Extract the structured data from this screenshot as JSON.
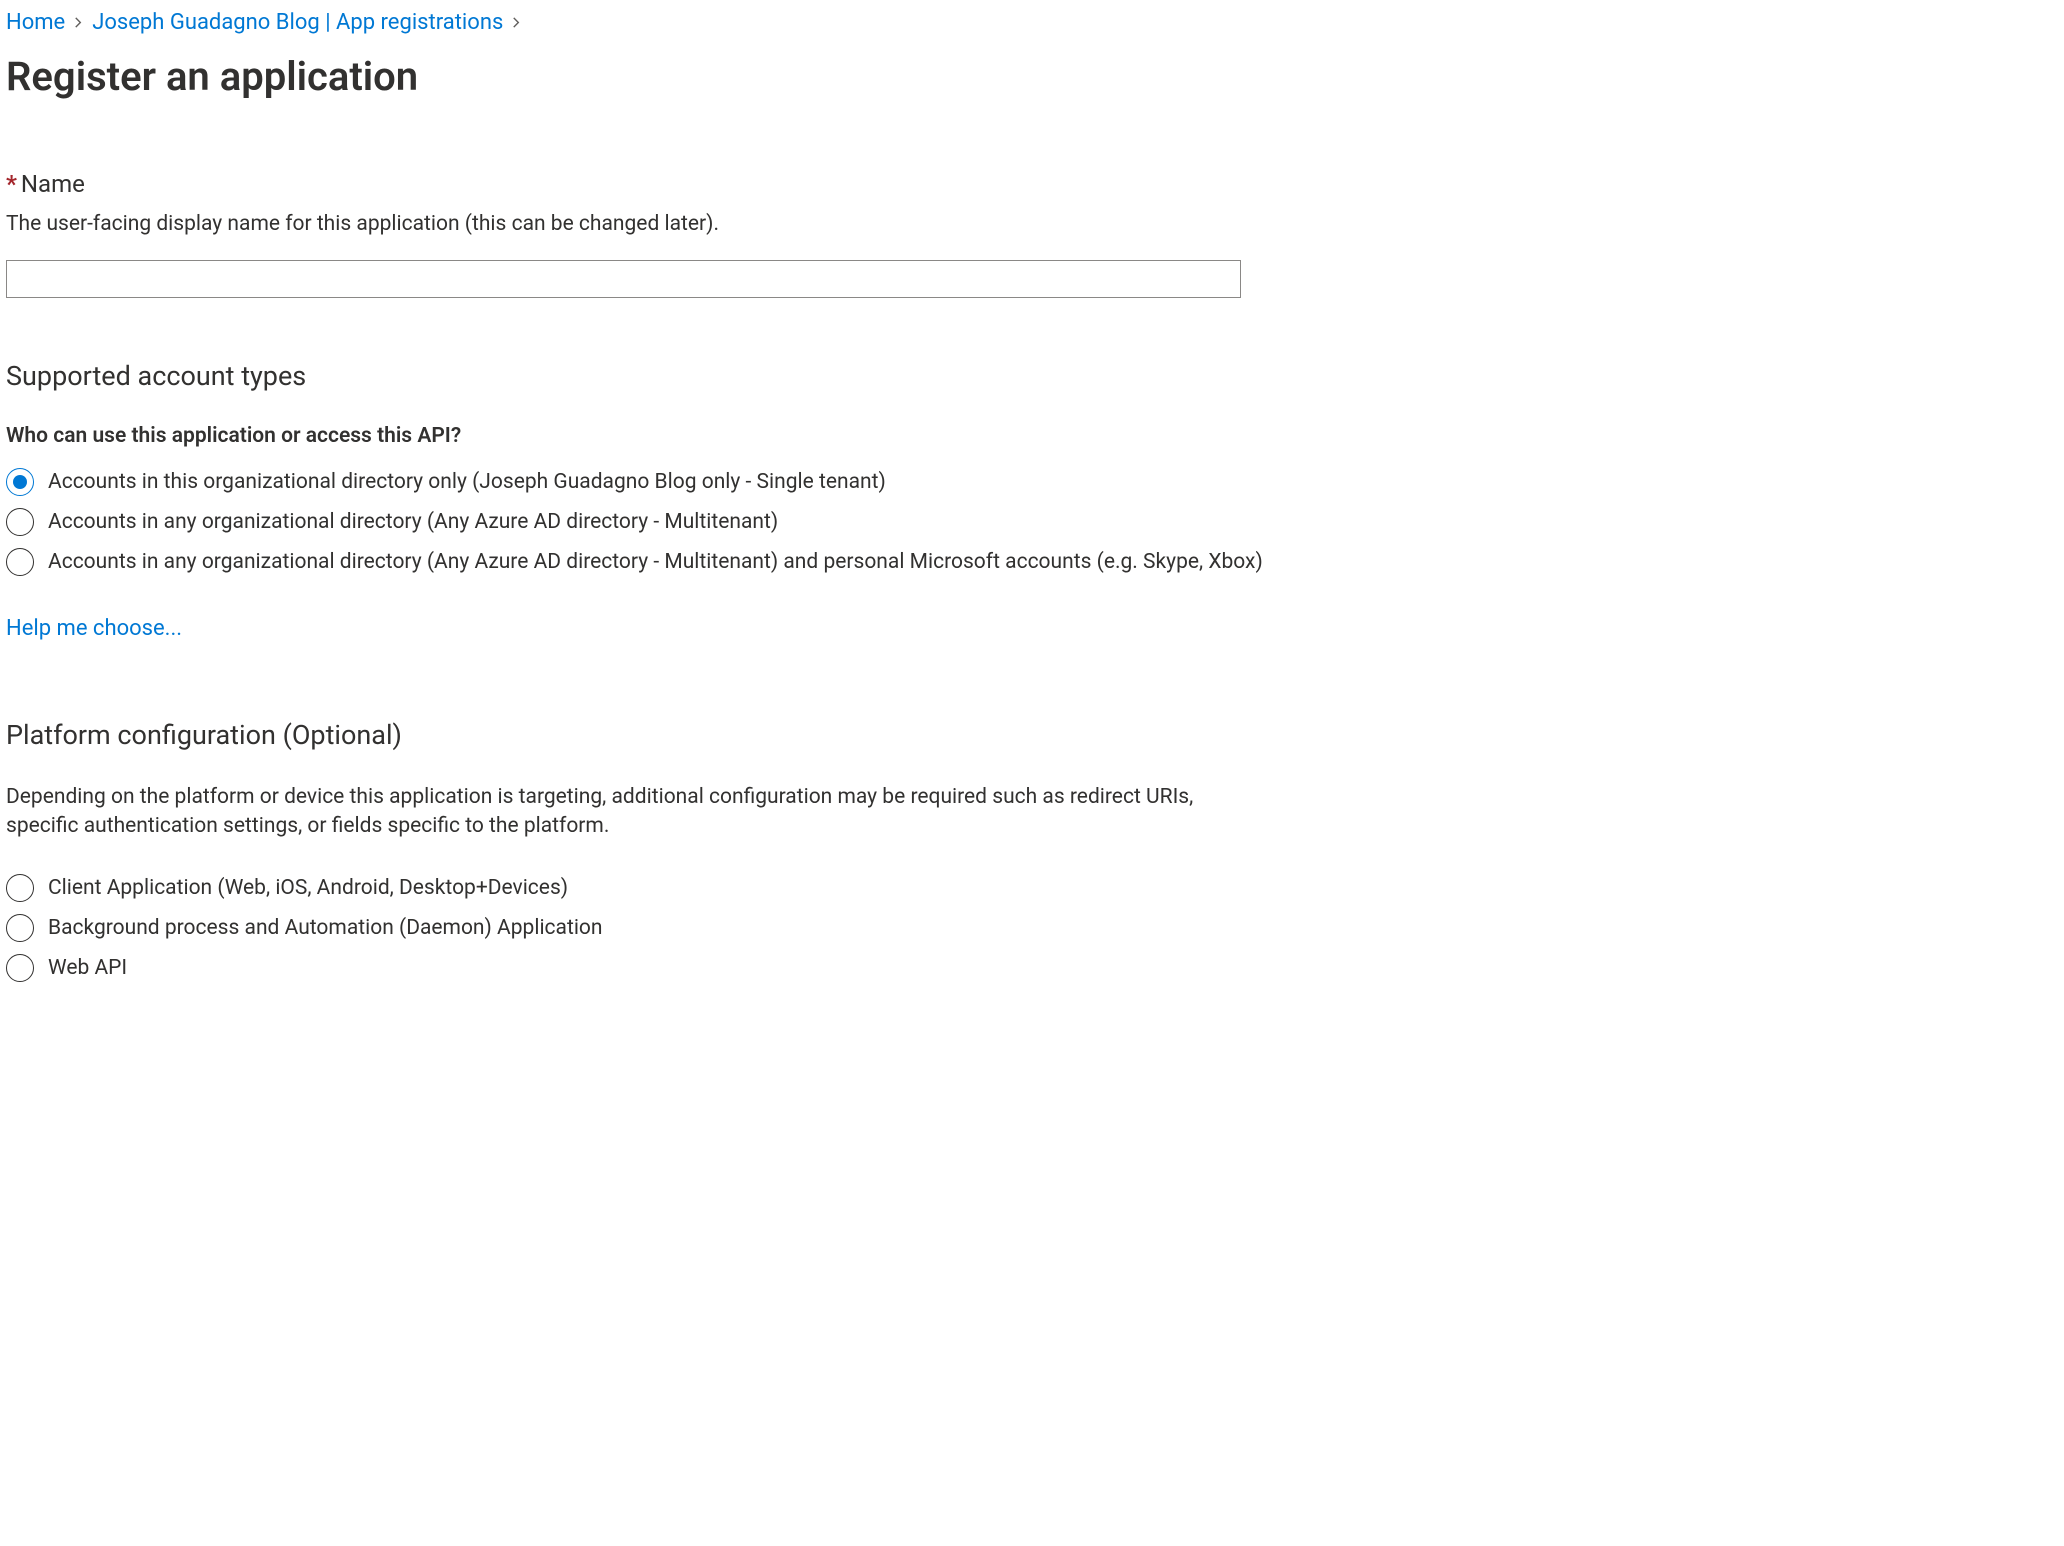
{
  "breadcrumb": {
    "items": [
      {
        "label": "Home"
      },
      {
        "label": "Joseph Guadagno Blog | App registrations"
      }
    ]
  },
  "page": {
    "title": "Register an application"
  },
  "nameField": {
    "label": "Name",
    "description": "The user-facing display name for this application (this can be changed later).",
    "value": ""
  },
  "accountTypes": {
    "heading": "Supported account types",
    "question": "Who can use this application or access this API?",
    "options": [
      {
        "label": "Accounts in this organizational directory only (Joseph Guadagno Blog only - Single tenant)",
        "selected": true
      },
      {
        "label": "Accounts in any organizational directory (Any Azure AD directory - Multitenant)",
        "selected": false
      },
      {
        "label": "Accounts in any organizational directory (Any Azure AD directory - Multitenant) and personal Microsoft accounts (e.g. Skype, Xbox)",
        "selected": false
      }
    ],
    "helpLink": "Help me choose..."
  },
  "platform": {
    "heading": "Platform configuration (Optional)",
    "description": "Depending on the platform or device this application is targeting, additional configuration may be required such as redirect URIs, specific authentication settings, or fields specific to the platform.",
    "options": [
      {
        "label": "Client Application (Web, iOS, Android, Desktop+Devices)",
        "selected": false
      },
      {
        "label": "Background process and Automation (Daemon) Application",
        "selected": false
      },
      {
        "label": "Web API",
        "selected": false
      }
    ]
  }
}
